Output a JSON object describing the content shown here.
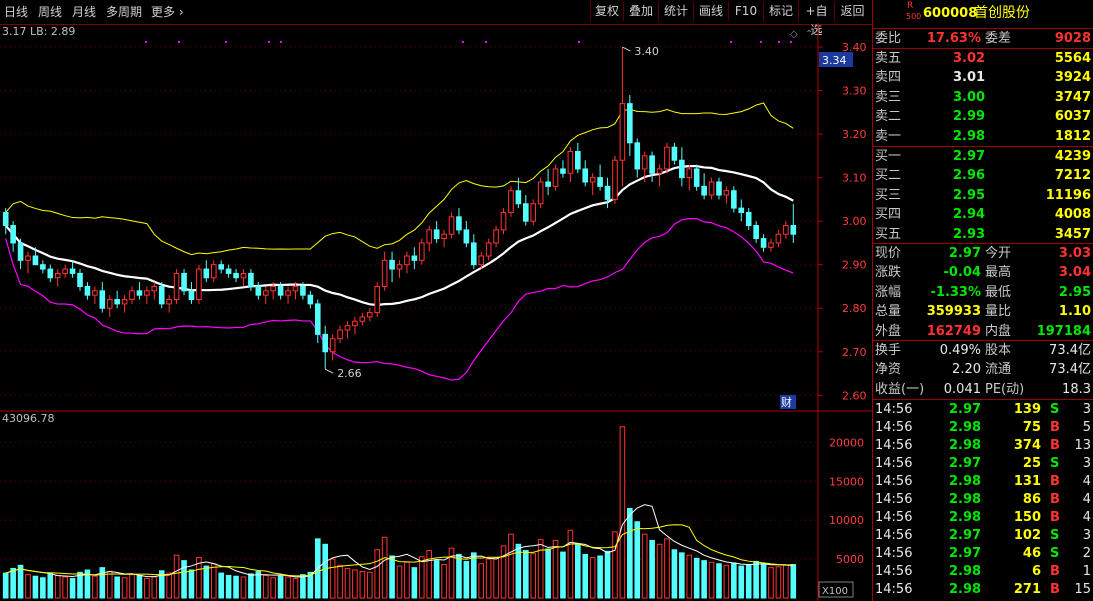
{
  "toolbar": {
    "periods": [
      "日线",
      "周线",
      "月线",
      "多周期",
      "更多"
    ],
    "buttons": [
      "复权",
      "叠加",
      "统计",
      "画线",
      "F10",
      "标记",
      "+自选",
      "返回"
    ]
  },
  "price_chart": {
    "indicator_text": "3.17  LB: 2.89",
    "y_ticks": [
      "3.40",
      "3.30",
      "3.20",
      "3.10",
      "3.00",
      "2.90",
      "2.80",
      "2.70",
      "2.60"
    ],
    "current_price_tag": "3.34",
    "high_annotation": "3.40",
    "low_annotation": "2.66",
    "cai_badge": "财"
  },
  "volume_chart": {
    "header": "43096.78",
    "y_ticks": [
      "20000",
      "15000",
      "10000",
      "5000"
    ],
    "unit": "X100"
  },
  "stock": {
    "badge_top": "R",
    "badge_bottom": "500",
    "code": "600008",
    "name": "首创股份"
  },
  "order_book": {
    "ratio_label": "委比",
    "ratio_value": "17.63%",
    "diff_label": "委差",
    "diff_value": "9028",
    "asks": [
      {
        "label": "卖五",
        "price": "3.02",
        "volume": "5564"
      },
      {
        "label": "卖四",
        "price": "3.01",
        "volume": "3924"
      },
      {
        "label": "卖三",
        "price": "3.00",
        "volume": "3747"
      },
      {
        "label": "卖二",
        "price": "2.99",
        "volume": "6037"
      },
      {
        "label": "卖一",
        "price": "2.98",
        "volume": "1812"
      }
    ],
    "bids": [
      {
        "label": "买一",
        "price": "2.97",
        "volume": "4239"
      },
      {
        "label": "买二",
        "price": "2.96",
        "volume": "7212"
      },
      {
        "label": "买三",
        "price": "2.95",
        "volume": "11196"
      },
      {
        "label": "买四",
        "price": "2.94",
        "volume": "4008"
      },
      {
        "label": "买五",
        "price": "2.93",
        "volume": "3457"
      }
    ]
  },
  "quote": {
    "rows": [
      {
        "l1": "现价",
        "v1": "2.97",
        "l2": "今开",
        "v2": "3.03"
      },
      {
        "l1": "涨跌",
        "v1": "-0.04",
        "l2": "最高",
        "v2": "3.04"
      },
      {
        "l1": "涨幅",
        "v1": "-1.33%",
        "l2": "最低",
        "v2": "2.95"
      },
      {
        "l1": "总量",
        "v1": "359933",
        "l2": "量比",
        "v2": "1.10"
      },
      {
        "l1": "外盘",
        "v1": "162749",
        "l2": "内盘",
        "v2": "197184"
      }
    ]
  },
  "fundamentals": {
    "rows": [
      {
        "l1": "换手",
        "v1": "0.49%",
        "l2": "股本",
        "v2": "73.4亿"
      },
      {
        "l1": "净资",
        "v1": "2.20",
        "l2": "流通",
        "v2": "73.4亿"
      },
      {
        "l1": "收益(一)",
        "v1": "0.041",
        "l2": "PE(动)",
        "v2": "18.3"
      }
    ]
  },
  "ticks": [
    {
      "time": "14:56",
      "price": "2.97",
      "vol": "139",
      "side": "S",
      "n": "3"
    },
    {
      "time": "14:56",
      "price": "2.98",
      "vol": "75",
      "side": "B",
      "n": "5"
    },
    {
      "time": "14:56",
      "price": "2.98",
      "vol": "374",
      "side": "B",
      "n": "13"
    },
    {
      "time": "14:56",
      "price": "2.97",
      "vol": "25",
      "side": "S",
      "n": "3"
    },
    {
      "time": "14:56",
      "price": "2.98",
      "vol": "131",
      "side": "B",
      "n": "4"
    },
    {
      "time": "14:56",
      "price": "2.98",
      "vol": "86",
      "side": "B",
      "n": "4"
    },
    {
      "time": "14:56",
      "price": "2.98",
      "vol": "150",
      "side": "B",
      "n": "4"
    },
    {
      "time": "14:56",
      "price": "2.97",
      "vol": "102",
      "side": "S",
      "n": "3"
    },
    {
      "time": "14:56",
      "price": "2.97",
      "vol": "46",
      "side": "S",
      "n": "2"
    },
    {
      "time": "14:56",
      "price": "2.98",
      "vol": "6",
      "side": "B",
      "n": "1"
    },
    {
      "time": "14:56",
      "price": "2.98",
      "vol": "271",
      "side": "B",
      "n": "15"
    }
  ],
  "chart_data": {
    "type": "candlestick",
    "price_ylim": [
      2.58,
      3.43
    ],
    "volume_ylim": [
      0,
      23000
    ],
    "candles": [
      [
        3.02,
        3.03,
        2.97,
        2.99,
        3200
      ],
      [
        2.99,
        3.0,
        2.93,
        2.95,
        3800
      ],
      [
        2.95,
        2.96,
        2.89,
        2.91,
        4200
      ],
      [
        2.91,
        2.93,
        2.88,
        2.92,
        3000
      ],
      [
        2.92,
        2.94,
        2.9,
        2.9,
        2800
      ],
      [
        2.9,
        2.91,
        2.88,
        2.89,
        2600
      ],
      [
        2.89,
        2.9,
        2.86,
        2.87,
        3100
      ],
      [
        2.87,
        2.89,
        2.85,
        2.88,
        2900
      ],
      [
        2.88,
        2.9,
        2.87,
        2.89,
        2700
      ],
      [
        2.89,
        2.91,
        2.87,
        2.88,
        2500
      ],
      [
        2.88,
        2.89,
        2.84,
        2.85,
        3300
      ],
      [
        2.85,
        2.86,
        2.82,
        2.83,
        3600
      ],
      [
        2.83,
        2.85,
        2.81,
        2.84,
        2800
      ],
      [
        2.84,
        2.86,
        2.79,
        2.8,
        3900
      ],
      [
        2.8,
        2.83,
        2.78,
        2.82,
        3400
      ],
      [
        2.82,
        2.84,
        2.8,
        2.81,
        2700
      ],
      [
        2.81,
        2.83,
        2.79,
        2.82,
        2600
      ],
      [
        2.82,
        2.85,
        2.81,
        2.84,
        3000
      ],
      [
        2.84,
        2.86,
        2.82,
        2.83,
        2900
      ],
      [
        2.83,
        2.85,
        2.81,
        2.84,
        2500
      ],
      [
        2.84,
        2.86,
        2.82,
        2.85,
        2700
      ],
      [
        2.85,
        2.86,
        2.8,
        2.81,
        3500
      ],
      [
        2.81,
        2.83,
        2.79,
        2.82,
        3200
      ],
      [
        2.82,
        2.89,
        2.81,
        2.88,
        5500
      ],
      [
        2.88,
        2.89,
        2.83,
        2.84,
        4800
      ],
      [
        2.84,
        2.86,
        2.81,
        2.82,
        3600
      ],
      [
        2.82,
        2.9,
        2.81,
        2.89,
        5200
      ],
      [
        2.89,
        2.91,
        2.86,
        2.87,
        4100
      ],
      [
        2.87,
        2.91,
        2.86,
        2.9,
        4400
      ],
      [
        2.9,
        2.91,
        2.88,
        2.89,
        3200
      ],
      [
        2.89,
        2.9,
        2.87,
        2.88,
        2900
      ],
      [
        2.88,
        2.89,
        2.86,
        2.87,
        2800
      ],
      [
        2.87,
        2.89,
        2.85,
        2.88,
        2700
      ],
      [
        2.88,
        2.89,
        2.84,
        2.85,
        3100
      ],
      [
        2.85,
        2.86,
        2.82,
        2.83,
        3400
      ],
      [
        2.83,
        2.85,
        2.81,
        2.84,
        2900
      ],
      [
        2.84,
        2.86,
        2.82,
        2.85,
        2600
      ],
      [
        2.85,
        2.86,
        2.82,
        2.83,
        2800
      ],
      [
        2.83,
        2.85,
        2.81,
        2.84,
        2700
      ],
      [
        2.84,
        2.86,
        2.82,
        2.85,
        2500
      ],
      [
        2.85,
        2.86,
        2.82,
        2.83,
        3000
      ],
      [
        2.83,
        2.84,
        2.8,
        2.81,
        3300
      ],
      [
        2.81,
        2.82,
        2.72,
        2.74,
        7600
      ],
      [
        2.74,
        2.76,
        2.66,
        2.7,
        6900
      ],
      [
        2.7,
        2.74,
        2.68,
        2.73,
        5000
      ],
      [
        2.73,
        2.76,
        2.72,
        2.75,
        4200
      ],
      [
        2.75,
        2.77,
        2.73,
        2.76,
        3800
      ],
      [
        2.76,
        2.78,
        2.74,
        2.77,
        3600
      ],
      [
        2.77,
        2.79,
        2.76,
        2.78,
        3400
      ],
      [
        2.78,
        2.8,
        2.77,
        2.79,
        3300
      ],
      [
        2.79,
        2.86,
        2.78,
        2.85,
        6200
      ],
      [
        2.85,
        2.93,
        2.84,
        2.91,
        7800
      ],
      [
        2.91,
        2.93,
        2.86,
        2.89,
        5400
      ],
      [
        2.89,
        2.91,
        2.87,
        2.9,
        4100
      ],
      [
        2.9,
        2.93,
        2.88,
        2.92,
        4600
      ],
      [
        2.92,
        2.94,
        2.89,
        2.91,
        3900
      ],
      [
        2.91,
        2.96,
        2.9,
        2.95,
        5300
      ],
      [
        2.95,
        2.99,
        2.93,
        2.98,
        6100
      ],
      [
        2.98,
        3.0,
        2.95,
        2.96,
        4800
      ],
      [
        2.96,
        2.98,
        2.94,
        2.97,
        4300
      ],
      [
        2.97,
        3.02,
        2.96,
        3.01,
        6400
      ],
      [
        3.01,
        3.03,
        2.97,
        2.98,
        5600
      ],
      [
        2.98,
        3.0,
        2.94,
        2.95,
        4700
      ],
      [
        2.95,
        2.97,
        2.89,
        2.9,
        5800
      ],
      [
        2.9,
        2.93,
        2.89,
        2.92,
        4400
      ],
      [
        2.92,
        2.96,
        2.91,
        2.95,
        5000
      ],
      [
        2.95,
        2.99,
        2.94,
        2.98,
        5200
      ],
      [
        2.98,
        3.03,
        2.97,
        3.02,
        6700
      ],
      [
        3.02,
        3.08,
        3.01,
        3.07,
        8200
      ],
      [
        3.07,
        3.1,
        3.03,
        3.04,
        6900
      ],
      [
        3.04,
        3.06,
        2.99,
        3.0,
        6100
      ],
      [
        3.0,
        3.05,
        2.99,
        3.04,
        5700
      ],
      [
        3.04,
        3.1,
        3.03,
        3.09,
        7500
      ],
      [
        3.09,
        3.12,
        3.06,
        3.08,
        6300
      ],
      [
        3.08,
        3.13,
        3.07,
        3.12,
        7400
      ],
      [
        3.12,
        3.14,
        3.1,
        3.11,
        5900
      ],
      [
        3.11,
        3.17,
        3.09,
        3.16,
        8700
      ],
      [
        3.16,
        3.18,
        3.11,
        3.12,
        6800
      ],
      [
        3.12,
        3.14,
        3.08,
        3.09,
        5600
      ],
      [
        3.09,
        3.11,
        3.06,
        3.1,
        5200
      ],
      [
        3.1,
        3.13,
        3.07,
        3.08,
        5400
      ],
      [
        3.08,
        3.1,
        3.03,
        3.05,
        6000
      ],
      [
        3.05,
        3.15,
        3.04,
        3.14,
        8500
      ],
      [
        3.14,
        3.4,
        3.08,
        3.27,
        22000
      ],
      [
        3.27,
        3.29,
        3.15,
        3.18,
        11500
      ],
      [
        3.18,
        3.19,
        3.1,
        3.12,
        9800
      ],
      [
        3.12,
        3.16,
        3.09,
        3.15,
        8200
      ],
      [
        3.15,
        3.16,
        3.09,
        3.11,
        7400
      ],
      [
        3.11,
        3.13,
        3.08,
        3.12,
        6900
      ],
      [
        3.12,
        3.18,
        3.11,
        3.17,
        7600
      ],
      [
        3.17,
        3.18,
        3.13,
        3.14,
        6200
      ],
      [
        3.14,
        3.17,
        3.08,
        3.1,
        5800
      ],
      [
        3.1,
        3.13,
        3.07,
        3.12,
        5500
      ],
      [
        3.12,
        3.13,
        3.07,
        3.08,
        5100
      ],
      [
        3.08,
        3.11,
        3.05,
        3.06,
        4800
      ],
      [
        3.06,
        3.1,
        3.05,
        3.09,
        4600
      ],
      [
        3.09,
        3.1,
        3.05,
        3.06,
        4400
      ],
      [
        3.06,
        3.08,
        3.04,
        3.07,
        4200
      ],
      [
        3.07,
        3.08,
        3.02,
        3.03,
        4500
      ],
      [
        3.03,
        3.05,
        3.0,
        3.02,
        4100
      ],
      [
        3.02,
        3.03,
        2.98,
        2.99,
        4300
      ],
      [
        2.99,
        3.0,
        2.95,
        2.96,
        4700
      ],
      [
        2.96,
        2.97,
        2.93,
        2.94,
        4400
      ],
      [
        2.94,
        2.96,
        2.93,
        2.95,
        3900
      ],
      [
        2.95,
        2.98,
        2.94,
        2.97,
        4000
      ],
      [
        2.97,
        3.0,
        2.96,
        2.99,
        4200
      ],
      [
        2.99,
        3.04,
        2.95,
        2.97,
        4300
      ]
    ]
  }
}
